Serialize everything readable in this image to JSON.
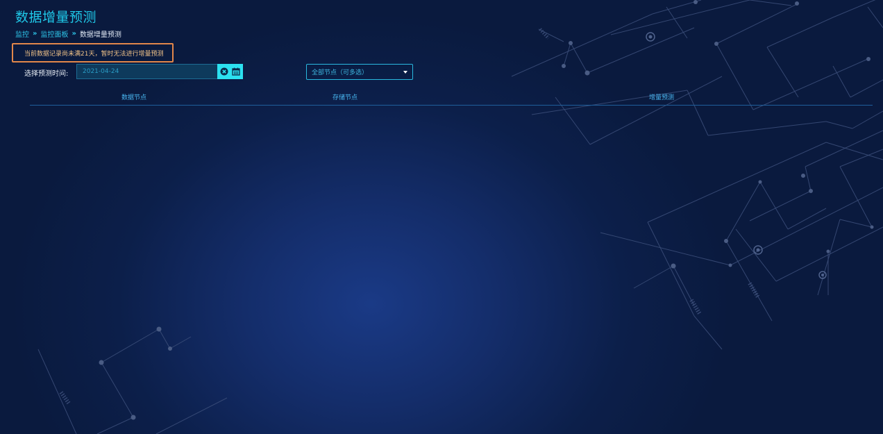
{
  "page": {
    "title": "数据增量预测"
  },
  "breadcrumb": {
    "items": [
      "监控",
      "监控面板",
      "数据增量预测"
    ],
    "separator": "»"
  },
  "warning": {
    "text": "当前数据记录尚未满21天，暂时无法进行增量预测"
  },
  "filters": {
    "date_label": "选择预测时间:",
    "date_value": "2021-04-24",
    "clear_icon": "clear-circle-icon",
    "calendar_icon": "calendar-icon",
    "node_select_value": "全部节点（可多选）",
    "node_select_icon": "caret-down-icon"
  },
  "table": {
    "columns": [
      "数据节点",
      "存储节点",
      "增量预测"
    ],
    "rows": []
  },
  "colors": {
    "title": "#1fc8e8",
    "accent": "#2ce1f0",
    "warning_border": "#e2874a",
    "warning_text": "#f0c288",
    "background": "#0c1f4a"
  }
}
